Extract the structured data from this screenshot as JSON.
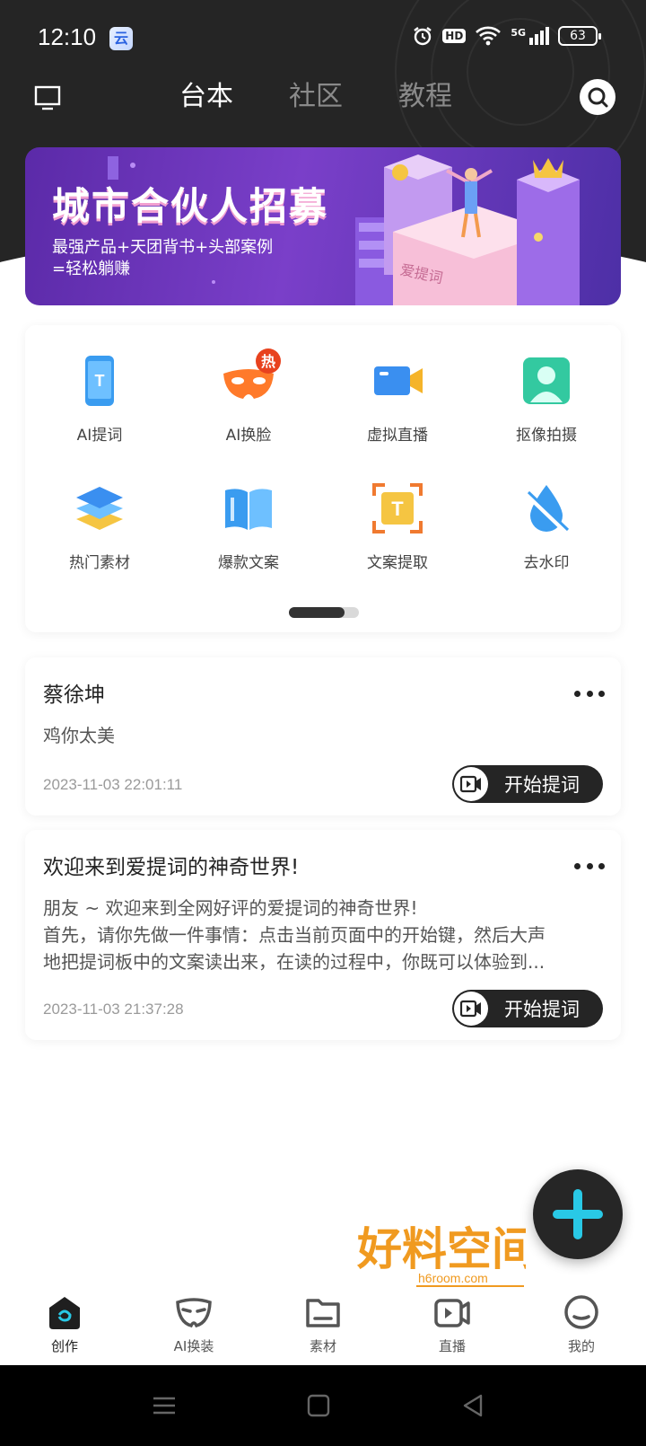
{
  "status_bar": {
    "time": "12:10",
    "network": "5G",
    "hd": "HD",
    "battery": "63"
  },
  "top_nav": {
    "tabs": [
      {
        "label": "台本",
        "active": true
      },
      {
        "label": "社区",
        "active": false
      },
      {
        "label": "教程",
        "active": false
      }
    ]
  },
  "banner": {
    "title": "城市合伙人招募",
    "subtitle_line1": "最强产品+天团背书+头部案例",
    "subtitle_line2": "=轻松躺赚",
    "building_sign": "爱提词"
  },
  "features": {
    "items": [
      {
        "label": "AI提词",
        "icon": "phone-teleprompter-icon",
        "color": "#3a9cf0"
      },
      {
        "label": "AI换脸",
        "icon": "mask-icon",
        "color": "#ff7a2a",
        "badge": "热"
      },
      {
        "label": "虚拟直播",
        "icon": "video-camera-icon",
        "color": "#3a8ff0"
      },
      {
        "label": "抠像拍摄",
        "icon": "portrait-icon",
        "color": "#33c9a0"
      },
      {
        "label": "热门素材",
        "icon": "layers-icon",
        "color": "#3aa0f0"
      },
      {
        "label": "爆款文案",
        "icon": "book-icon",
        "color": "#3a9cf0"
      },
      {
        "label": "文案提取",
        "icon": "text-scan-icon",
        "color": "#f5b42a"
      },
      {
        "label": "去水印",
        "icon": "water-drop-off-icon",
        "color": "#3a9cf0"
      }
    ],
    "page_indicator": {
      "pages": 2,
      "current": 1
    }
  },
  "scripts": [
    {
      "title": "蔡徐坤",
      "body_lines": [
        "鸡你太美"
      ],
      "date": "2023-11-03 22:01:11",
      "button_label": "开始提词"
    },
    {
      "title": "欢迎来到爱提词的神奇世界!",
      "body_lines": [
        "朋友 ~ 欢迎来到全网好评的爱提词的神奇世界!",
        "首先，请你先做一件事情：点击当前页面中的开始键，然后大声",
        "地把提词板中的文案读出来，在读的过程中，你既可以体验到..."
      ],
      "date": "2023-11-03 21:37:28",
      "button_label": "开始提词"
    }
  ],
  "watermark": {
    "main": "好料空间",
    "url": "h6room.com"
  },
  "bottom_nav": {
    "items": [
      {
        "label": "创作",
        "icon": "create-home-icon",
        "active": true
      },
      {
        "label": "AI换装",
        "icon": "mask-outline-icon",
        "active": false
      },
      {
        "label": "素材",
        "icon": "folder-icon",
        "active": false
      },
      {
        "label": "直播",
        "icon": "live-video-icon",
        "active": false
      },
      {
        "label": "我的",
        "icon": "profile-face-icon",
        "active": false
      }
    ]
  },
  "colors": {
    "header_bg": "#252525",
    "accent_cyan": "#29c9e6",
    "button_dark": "#252525"
  }
}
